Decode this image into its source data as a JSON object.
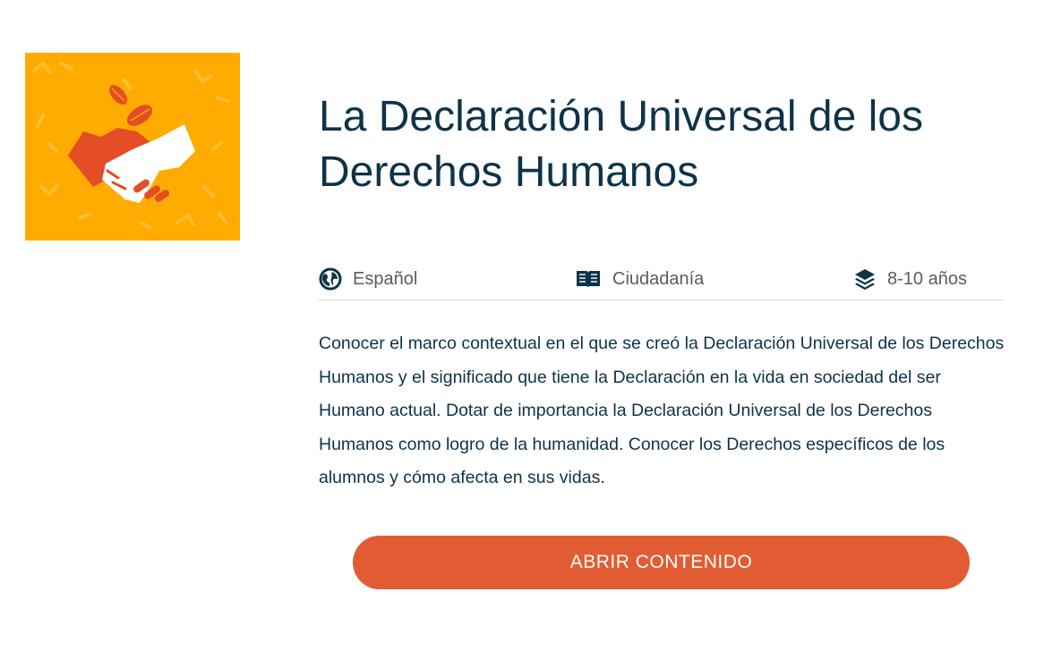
{
  "card": {
    "image": {
      "icon": "handshake-icon",
      "background_color": "#ffaa00",
      "accent_color": "#e44d26"
    },
    "title": "La Declaración Universal de los Derechos Humanos",
    "meta": {
      "language": {
        "icon": "globe-icon",
        "label": "Español"
      },
      "subject": {
        "icon": "open-book-icon",
        "label": "Ciudadanía"
      },
      "age": {
        "icon": "layers-icon",
        "label": "8-10 años"
      }
    },
    "description": "Conocer el marco contextual en el que se creó la Declaración Universal de los Derechos Humanos y el significado que tiene la Declaración en la vida en sociedad del ser Humano actual. Dotar de importancia la Declaración Universal de los Derechos Humanos como logro de la humanidad. Conocer los Derechos específicos de los alumnos y cómo afecta en sus vidas.",
    "cta_label": "ABRIR CONTENIDO",
    "colors": {
      "title": "#0d3349",
      "meta_text": "#5c5c5c",
      "button": "#e25c33"
    }
  }
}
